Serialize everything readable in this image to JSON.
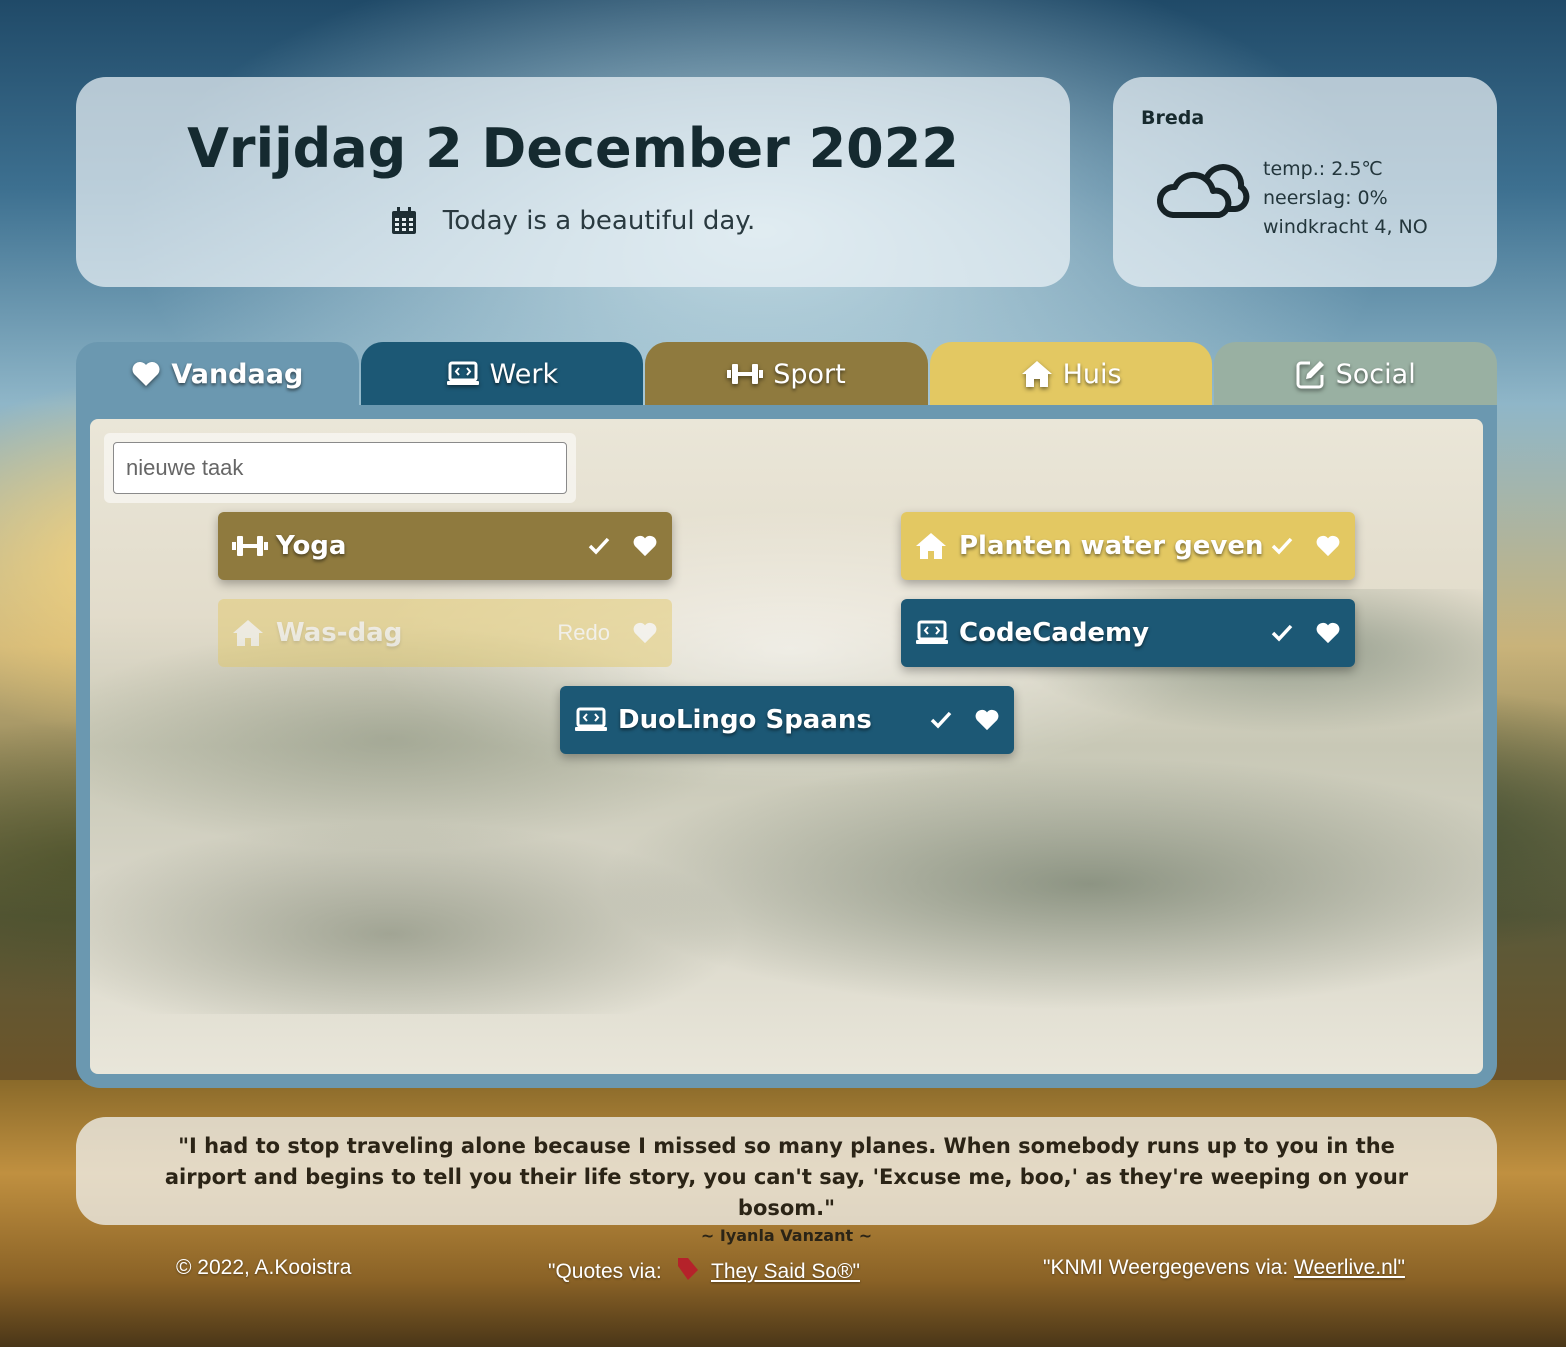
{
  "header": {
    "date_title": "Vrijdag 2 December 2022",
    "subtitle": "Today is a beautiful day.",
    "icon": "calendar-icon"
  },
  "weather": {
    "city": "Breda",
    "icon": "cloud-icon",
    "temp": "temp.: 2.5℃",
    "precipitation": "neerslag: 0%",
    "wind": "windkracht 4, NO"
  },
  "tabs": [
    {
      "label": "Vandaag",
      "icon": "heart-icon",
      "color": "#6b98b0",
      "active": true
    },
    {
      "label": "Werk",
      "icon": "laptop-code-icon",
      "color": "#1c5875"
    },
    {
      "label": "Sport",
      "icon": "dumbbell-icon",
      "color": "#8f7a3e"
    },
    {
      "label": "Huis",
      "icon": "house-icon",
      "color": "#e3c862"
    },
    {
      "label": "Social",
      "icon": "edit-icon",
      "color": "#99b0a2"
    }
  ],
  "new_task": {
    "placeholder": "nieuwe taak",
    "value": ""
  },
  "tasks": [
    {
      "label": "Yoga",
      "category": "Sport",
      "icon": "dumbbell-icon",
      "color": "#8f7a3e",
      "done": false
    },
    {
      "label": "Was-dag",
      "category": "Huis",
      "icon": "house-icon",
      "color": "#e3c862",
      "done": true,
      "action": "Redo"
    },
    {
      "label": "Planten water geven",
      "category": "Huis",
      "icon": "house-icon",
      "color": "#e3c862",
      "done": false
    },
    {
      "label": "CodeCademy",
      "category": "Werk",
      "icon": "laptop-code-icon",
      "color": "#1c5875",
      "done": false
    },
    {
      "label": "DuoLingo Spaans",
      "category": "Werk",
      "icon": "laptop-code-icon",
      "color": "#1c5875",
      "done": false
    }
  ],
  "quote": {
    "text": "\"I had to stop traveling alone because I missed so many planes. When somebody runs up to you in the airport and begins to tell you their life story, you can't say, 'Excuse me, boo,' as they're weeping on your bosom.\"",
    "author": "~ Iyanla Vanzant ~"
  },
  "footer": {
    "copyright": "© 2022, A.Kooistra",
    "quotes_prefix": "\"Quotes via:",
    "quotes_link": "They Said So®\"",
    "weather_prefix": "\"KNMI Weergegevens via:",
    "weather_link": "Weerlive.nl\""
  }
}
